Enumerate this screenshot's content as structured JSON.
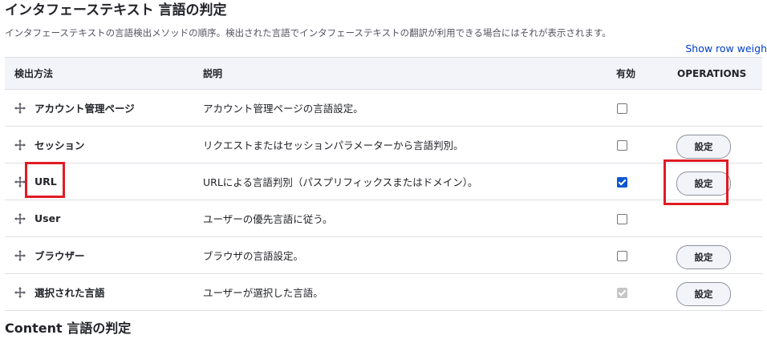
{
  "page": {
    "title": "インタフェーステキスト 言語の判定",
    "description": "インタフェーステキストの言語検出メソッドの順序。検出された言語でインタフェーステキストの翻訳が利用できる場合にはそれが表示されます。",
    "show_row_weights_label": "Show row weigh"
  },
  "table": {
    "headers": {
      "method": "検出方法",
      "description": "説明",
      "enabled": "有効",
      "operations": "OPERATIONS"
    },
    "rows": [
      {
        "name": "アカウント管理ページ",
        "description": "アカウント管理ページの言語設定。",
        "enabled": false,
        "disabled": false,
        "operation": ""
      },
      {
        "name": "セッション",
        "description": "リクエストまたはセッションパラメーターから言語判別。",
        "enabled": false,
        "disabled": false,
        "operation": "設定"
      },
      {
        "name": "URL",
        "description": "URLによる言語判別（パスプリフィックスまたはドメイン）。",
        "enabled": true,
        "disabled": false,
        "operation": "設定"
      },
      {
        "name": "User",
        "description": "ユーザーの優先言語に従う。",
        "enabled": false,
        "disabled": false,
        "operation": ""
      },
      {
        "name": "ブラウザー",
        "description": "ブラウザの言語設定。",
        "enabled": false,
        "disabled": false,
        "operation": "設定"
      },
      {
        "name": "選択された言語",
        "description": "ユーザーが選択した言語。",
        "enabled": true,
        "disabled": true,
        "operation": "設定"
      }
    ]
  },
  "section2": {
    "title": "Content 言語の判定"
  },
  "icons": {
    "drag_handle": "move-arrows-icon"
  },
  "colors": {
    "link": "#003ecc",
    "checkbox_checked": "#0b57d0",
    "highlight": "#e01b24",
    "header_bg": "#f3f4f9"
  }
}
